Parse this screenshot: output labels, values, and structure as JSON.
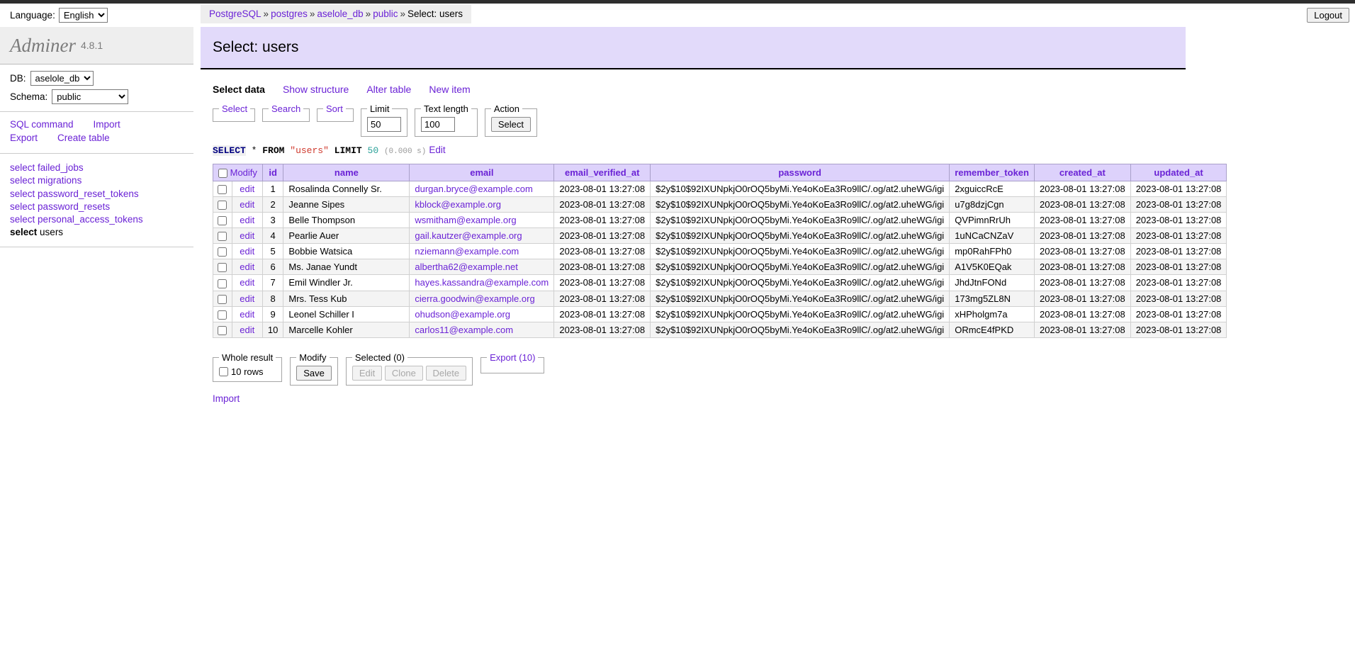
{
  "topbar": {
    "language_label": "Language:",
    "language_value": "English",
    "language_options": [
      "English"
    ],
    "logout_label": "Logout"
  },
  "breadcrumb": {
    "items": [
      "PostgreSQL",
      "postgres",
      "aselole_db",
      "public"
    ],
    "current": "Select: users",
    "separator": "»"
  },
  "sidebar": {
    "brand": "Adminer",
    "version": "4.8.1",
    "db_label": "DB:",
    "db_value": "aselole_db",
    "db_options": [
      "aselole_db"
    ],
    "schema_label": "Schema:",
    "schema_value": "public",
    "schema_options": [
      "public"
    ],
    "actions": [
      "SQL command",
      "Import",
      "Export",
      "Create table"
    ],
    "tables": [
      {
        "verb": "select",
        "name": "failed_jobs",
        "active": false
      },
      {
        "verb": "select",
        "name": "migrations",
        "active": false
      },
      {
        "verb": "select",
        "name": "password_reset_tokens",
        "active": false
      },
      {
        "verb": "select",
        "name": "password_resets",
        "active": false
      },
      {
        "verb": "select",
        "name": "personal_access_tokens",
        "active": false
      },
      {
        "verb": "select",
        "name": "users",
        "active": true
      }
    ]
  },
  "page": {
    "title": "Select: users",
    "tabs": [
      {
        "label": "Select data",
        "active": true
      },
      {
        "label": "Show structure",
        "active": false
      },
      {
        "label": "Alter table",
        "active": false
      },
      {
        "label": "New item",
        "active": false
      }
    ]
  },
  "toolbar": {
    "select_legend": "Select",
    "search_legend": "Search",
    "sort_legend": "Sort",
    "limit_legend": "Limit",
    "limit_value": "50",
    "textlength_legend": "Text length",
    "textlength_value": "100",
    "action_legend": "Action",
    "select_button": "Select"
  },
  "sql": {
    "keyword1": "SELECT",
    "star": "*",
    "from": "FROM",
    "table": "\"users\"",
    "limit_kw": "LIMIT",
    "limit_num": "50",
    "time": "(0.000 s)",
    "edit_link": "Edit"
  },
  "table": {
    "columns": [
      "Modify",
      "id",
      "name",
      "email",
      "email_verified_at",
      "password",
      "remember_token",
      "created_at",
      "updated_at"
    ],
    "edit_label": "edit",
    "rows": [
      {
        "id": "1",
        "name": "Rosalinda Connelly Sr.",
        "email": "durgan.bryce@example.com",
        "email_verified_at": "2023-08-01 13:27:08",
        "password": "$2y$10$92IXUNpkjO0rOQ5byMi.Ye4oKoEa3Ro9llC/.og/at2.uheWG/igi",
        "remember_token": "2xguiccRcE",
        "created_at": "2023-08-01 13:27:08",
        "updated_at": "2023-08-01 13:27:08"
      },
      {
        "id": "2",
        "name": "Jeanne Sipes",
        "email": "kblock@example.org",
        "email_verified_at": "2023-08-01 13:27:08",
        "password": "$2y$10$92IXUNpkjO0rOQ5byMi.Ye4oKoEa3Ro9llC/.og/at2.uheWG/igi",
        "remember_token": "u7g8dzjCgn",
        "created_at": "2023-08-01 13:27:08",
        "updated_at": "2023-08-01 13:27:08"
      },
      {
        "id": "3",
        "name": "Belle Thompson",
        "email": "wsmitham@example.org",
        "email_verified_at": "2023-08-01 13:27:08",
        "password": "$2y$10$92IXUNpkjO0rOQ5byMi.Ye4oKoEa3Ro9llC/.og/at2.uheWG/igi",
        "remember_token": "QVPimnRrUh",
        "created_at": "2023-08-01 13:27:08",
        "updated_at": "2023-08-01 13:27:08"
      },
      {
        "id": "4",
        "name": "Pearlie Auer",
        "email": "gail.kautzer@example.org",
        "email_verified_at": "2023-08-01 13:27:08",
        "password": "$2y$10$92IXUNpkjO0rOQ5byMi.Ye4oKoEa3Ro9llC/.og/at2.uheWG/igi",
        "remember_token": "1uNCaCNZaV",
        "created_at": "2023-08-01 13:27:08",
        "updated_at": "2023-08-01 13:27:08"
      },
      {
        "id": "5",
        "name": "Bobbie Watsica",
        "email": "nziemann@example.com",
        "email_verified_at": "2023-08-01 13:27:08",
        "password": "$2y$10$92IXUNpkjO0rOQ5byMi.Ye4oKoEa3Ro9llC/.og/at2.uheWG/igi",
        "remember_token": "mp0RahFPh0",
        "created_at": "2023-08-01 13:27:08",
        "updated_at": "2023-08-01 13:27:08"
      },
      {
        "id": "6",
        "name": "Ms. Janae Yundt",
        "email": "albertha62@example.net",
        "email_verified_at": "2023-08-01 13:27:08",
        "password": "$2y$10$92IXUNpkjO0rOQ5byMi.Ye4oKoEa3Ro9llC/.og/at2.uheWG/igi",
        "remember_token": "A1V5K0EQak",
        "created_at": "2023-08-01 13:27:08",
        "updated_at": "2023-08-01 13:27:08"
      },
      {
        "id": "7",
        "name": "Emil Windler Jr.",
        "email": "hayes.kassandra@example.com",
        "email_verified_at": "2023-08-01 13:27:08",
        "password": "$2y$10$92IXUNpkjO0rOQ5byMi.Ye4oKoEa3Ro9llC/.og/at2.uheWG/igi",
        "remember_token": "JhdJtnFONd",
        "created_at": "2023-08-01 13:27:08",
        "updated_at": "2023-08-01 13:27:08"
      },
      {
        "id": "8",
        "name": "Mrs. Tess Kub",
        "email": "cierra.goodwin@example.org",
        "email_verified_at": "2023-08-01 13:27:08",
        "password": "$2y$10$92IXUNpkjO0rOQ5byMi.Ye4oKoEa3Ro9llC/.og/at2.uheWG/igi",
        "remember_token": "173mg5ZL8N",
        "created_at": "2023-08-01 13:27:08",
        "updated_at": "2023-08-01 13:27:08"
      },
      {
        "id": "9",
        "name": "Leonel Schiller I",
        "email": "ohudson@example.org",
        "email_verified_at": "2023-08-01 13:27:08",
        "password": "$2y$10$92IXUNpkjO0rOQ5byMi.Ye4oKoEa3Ro9llC/.og/at2.uheWG/igi",
        "remember_token": "xHPholgm7a",
        "created_at": "2023-08-01 13:27:08",
        "updated_at": "2023-08-01 13:27:08"
      },
      {
        "id": "10",
        "name": "Marcelle Kohler",
        "email": "carlos11@example.com",
        "email_verified_at": "2023-08-01 13:27:08",
        "password": "$2y$10$92IXUNpkjO0rOQ5byMi.Ye4oKoEa3Ro9llC/.og/at2.uheWG/igi",
        "remember_token": "ORmcE4fPKD",
        "created_at": "2023-08-01 13:27:08",
        "updated_at": "2023-08-01 13:27:08"
      }
    ]
  },
  "footer": {
    "whole_result_legend": "Whole result",
    "rows_label": "10 rows",
    "modify_legend": "Modify",
    "save_label": "Save",
    "selected_legend": "Selected (0)",
    "edit_label": "Edit",
    "clone_label": "Clone",
    "delete_label": "Delete",
    "export_legend": "Export (10)",
    "import_link": "Import"
  },
  "colors": {
    "accent": "#6b23d6",
    "title_bg": "#e2dafa",
    "header_bg": "#ddd2fb"
  }
}
